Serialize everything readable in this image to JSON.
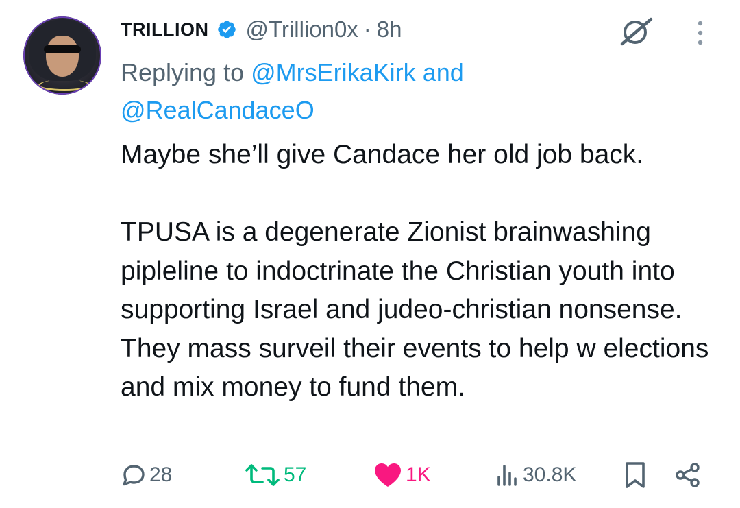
{
  "author": {
    "display_name": "TRILLION",
    "handle": "@Trillion0x",
    "separator": "·",
    "time": "8h"
  },
  "reply": {
    "prefix": "Replying to",
    "mentions": [
      "@MrsErikaKirk",
      "@RealCandaceO"
    ],
    "conjunction": "and"
  },
  "tweet": {
    "paragraphs": [
      "Maybe she’ll give Candace her old job back.",
      "TPUSA is a degenerate Zionist brainwashing pipleline to indoctrinate the Christian youth into supporting Israel and judeo-christian nonsense. They mass surveil their events to help w elections and mix money to fund them."
    ]
  },
  "actions": {
    "replies": "28",
    "reposts": "57",
    "likes": "1K",
    "views": "30.8K"
  },
  "icons": {
    "verified": "verified-badge-icon",
    "grok": "grok-icon",
    "more": "more-vertical-icon",
    "reply": "reply-bubble-icon",
    "repost": "repost-icon",
    "like": "heart-icon",
    "views": "views-bar-icon",
    "bookmark": "bookmark-icon",
    "share": "share-icon"
  },
  "colors": {
    "text": "#0f1419",
    "muted": "#536471",
    "link": "#1d9bf0",
    "verified": "#1d9bf0",
    "repost_active": "#00ba7c",
    "like_active": "#f91880"
  }
}
